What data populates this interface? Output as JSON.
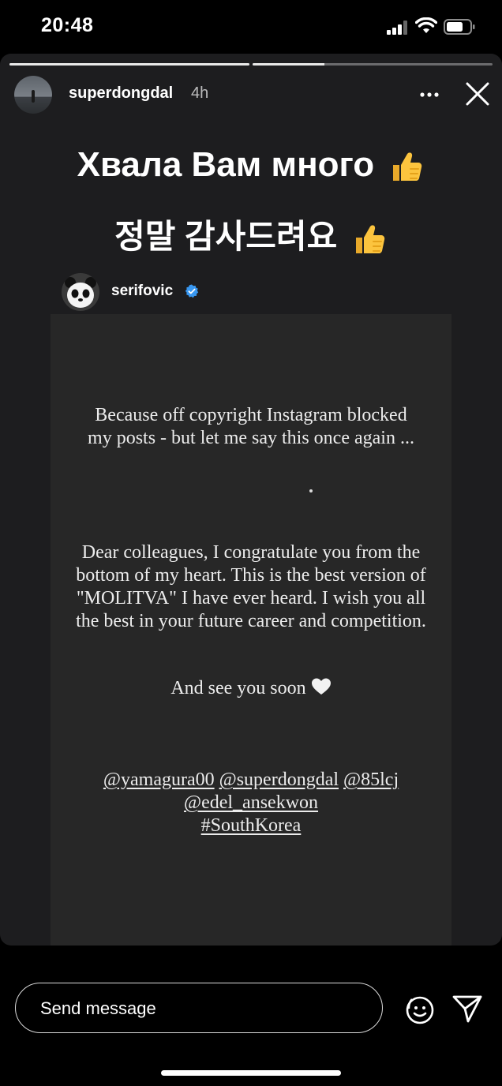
{
  "status_bar": {
    "time": "20:48"
  },
  "story": {
    "progress": [
      1.0,
      0.3
    ],
    "progress_color": "#e9e9e9",
    "username": "superdongdal",
    "time_ago": "4h",
    "headline_1": "Хвала Вам много",
    "headline_2": "정말 감사드려요",
    "headline_emoji": "thumbs-up-icon"
  },
  "shared_post": {
    "username": "serifovic",
    "verified": true,
    "verified_color": "#3897f0",
    "paragraph_1": "Because off copyright Instagram blocked my posts - but let me say this once again ...",
    "paragraph_2": "Dear colleagues, I congratulate you from the bottom of my heart. This is the best version of \"MOLITVA\" I have ever heard.  I wish you all the best in your future career and competition.",
    "paragraph_3": "And see you soon",
    "tags": [
      "@yamagura00",
      "@superdongdal",
      "@85lcj",
      "@edel_ansekwon",
      "#SouthKorea"
    ]
  },
  "message_bar": {
    "placeholder": "Send message"
  }
}
